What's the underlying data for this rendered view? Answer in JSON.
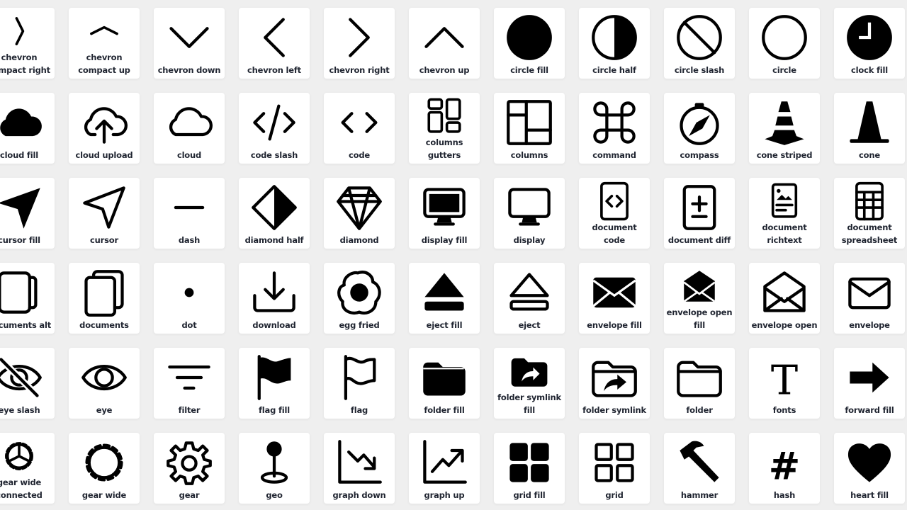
{
  "icons": [
    {
      "label": "chevron compact right",
      "icon": "chevron-compact-right"
    },
    {
      "label": "chevron compact up",
      "icon": "chevron-compact-up"
    },
    {
      "label": "chevron down",
      "icon": "chevron-down"
    },
    {
      "label": "chevron left",
      "icon": "chevron-left"
    },
    {
      "label": "chevron right",
      "icon": "chevron-right"
    },
    {
      "label": "chevron up",
      "icon": "chevron-up"
    },
    {
      "label": "circle fill",
      "icon": "circle-fill"
    },
    {
      "label": "circle half",
      "icon": "circle-half"
    },
    {
      "label": "circle slash",
      "icon": "circle-slash"
    },
    {
      "label": "circle",
      "icon": "circle"
    },
    {
      "label": "clock fill",
      "icon": "clock-fill"
    },
    {
      "label": "cloud fill",
      "icon": "cloud-fill"
    },
    {
      "label": "cloud upload",
      "icon": "cloud-upload"
    },
    {
      "label": "cloud",
      "icon": "cloud"
    },
    {
      "label": "code slash",
      "icon": "code-slash"
    },
    {
      "label": "code",
      "icon": "code"
    },
    {
      "label": "columns gutters",
      "icon": "columns-gutters"
    },
    {
      "label": "columns",
      "icon": "columns"
    },
    {
      "label": "command",
      "icon": "command"
    },
    {
      "label": "compass",
      "icon": "compass"
    },
    {
      "label": "cone striped",
      "icon": "cone-striped"
    },
    {
      "label": "cone",
      "icon": "cone"
    },
    {
      "label": "cursor fill",
      "icon": "cursor-fill"
    },
    {
      "label": "cursor",
      "icon": "cursor"
    },
    {
      "label": "dash",
      "icon": "dash"
    },
    {
      "label": "diamond half",
      "icon": "diamond-half"
    },
    {
      "label": "diamond",
      "icon": "diamond"
    },
    {
      "label": "display fill",
      "icon": "display-fill"
    },
    {
      "label": "display",
      "icon": "display"
    },
    {
      "label": "document code",
      "icon": "document-code"
    },
    {
      "label": "document diff",
      "icon": "document-diff"
    },
    {
      "label": "document richtext",
      "icon": "document-richtext"
    },
    {
      "label": "document spreadsheet",
      "icon": "document-spreadsheet"
    },
    {
      "label": "documents alt",
      "icon": "documents-alt"
    },
    {
      "label": "documents",
      "icon": "documents"
    },
    {
      "label": "dot",
      "icon": "dot"
    },
    {
      "label": "download",
      "icon": "download"
    },
    {
      "label": "egg fried",
      "icon": "egg-fried"
    },
    {
      "label": "eject fill",
      "icon": "eject-fill"
    },
    {
      "label": "eject",
      "icon": "eject"
    },
    {
      "label": "envelope fill",
      "icon": "envelope-fill"
    },
    {
      "label": "envelope open fill",
      "icon": "envelope-open-fill"
    },
    {
      "label": "envelope open",
      "icon": "envelope-open"
    },
    {
      "label": "envelope",
      "icon": "envelope"
    },
    {
      "label": "eye slash",
      "icon": "eye-slash"
    },
    {
      "label": "eye",
      "icon": "eye"
    },
    {
      "label": "filter",
      "icon": "filter"
    },
    {
      "label": "flag fill",
      "icon": "flag-fill"
    },
    {
      "label": "flag",
      "icon": "flag"
    },
    {
      "label": "folder fill",
      "icon": "folder-fill"
    },
    {
      "label": "folder symlink fill",
      "icon": "folder-symlink-fill"
    },
    {
      "label": "folder symlink",
      "icon": "folder-symlink"
    },
    {
      "label": "folder",
      "icon": "folder"
    },
    {
      "label": "fonts",
      "icon": "fonts"
    },
    {
      "label": "forward fill",
      "icon": "forward-fill"
    },
    {
      "label": "gear wide connected",
      "icon": "gear-wide-connected"
    },
    {
      "label": "gear wide",
      "icon": "gear-wide"
    },
    {
      "label": "gear",
      "icon": "gear"
    },
    {
      "label": "geo",
      "icon": "geo"
    },
    {
      "label": "graph down",
      "icon": "graph-down"
    },
    {
      "label": "graph up",
      "icon": "graph-up"
    },
    {
      "label": "grid fill",
      "icon": "grid-fill"
    },
    {
      "label": "grid",
      "icon": "grid"
    },
    {
      "label": "hammer",
      "icon": "hammer"
    },
    {
      "label": "hash",
      "icon": "hash"
    },
    {
      "label": "heart fill",
      "icon": "heart-fill"
    }
  ]
}
